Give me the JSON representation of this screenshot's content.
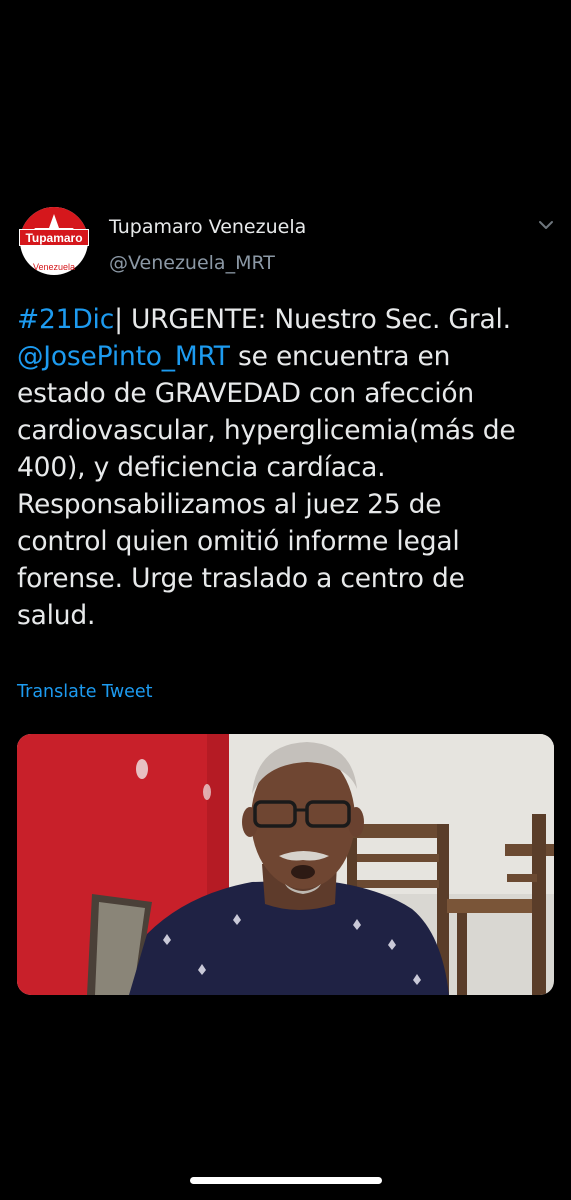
{
  "tweet": {
    "author_name": "Tupamaro Venezuela",
    "author_handle": "@Venezuela_MRT",
    "avatar_logo_text_top": "Tupamaro",
    "avatar_logo_text_bottom": "Venezuela",
    "body_lines": [
      {
        "link": "#21Dic",
        "text": "| URGENTE: Nuestro Sec. Gral."
      },
      {
        "link": "@JosePinto_MRT",
        "text": " se encuentra en"
      },
      {
        "link": "",
        "text": "estado de GRAVEDAD con afección"
      },
      {
        "link": "",
        "text": "cardiovascular, hyperglicemia(más de"
      },
      {
        "link": "",
        "text": "400), y deficiencia cardíaca."
      },
      {
        "link": "",
        "text": "Responsabilizamos al juez 25 de"
      },
      {
        "link": "",
        "text": "control  quien omitió informe legal"
      },
      {
        "link": "",
        "text": "forense. Urge traslado a centro de"
      },
      {
        "link": "",
        "text": "salud."
      }
    ],
    "translate_label": "Translate Tweet",
    "more_icon": "chevron-down-icon"
  },
  "colors": {
    "background": "#000000",
    "text": "#e7e9ea",
    "secondary_text": "#8b98a5",
    "link": "#1d9bf0",
    "logo_red": "#d5171c"
  }
}
